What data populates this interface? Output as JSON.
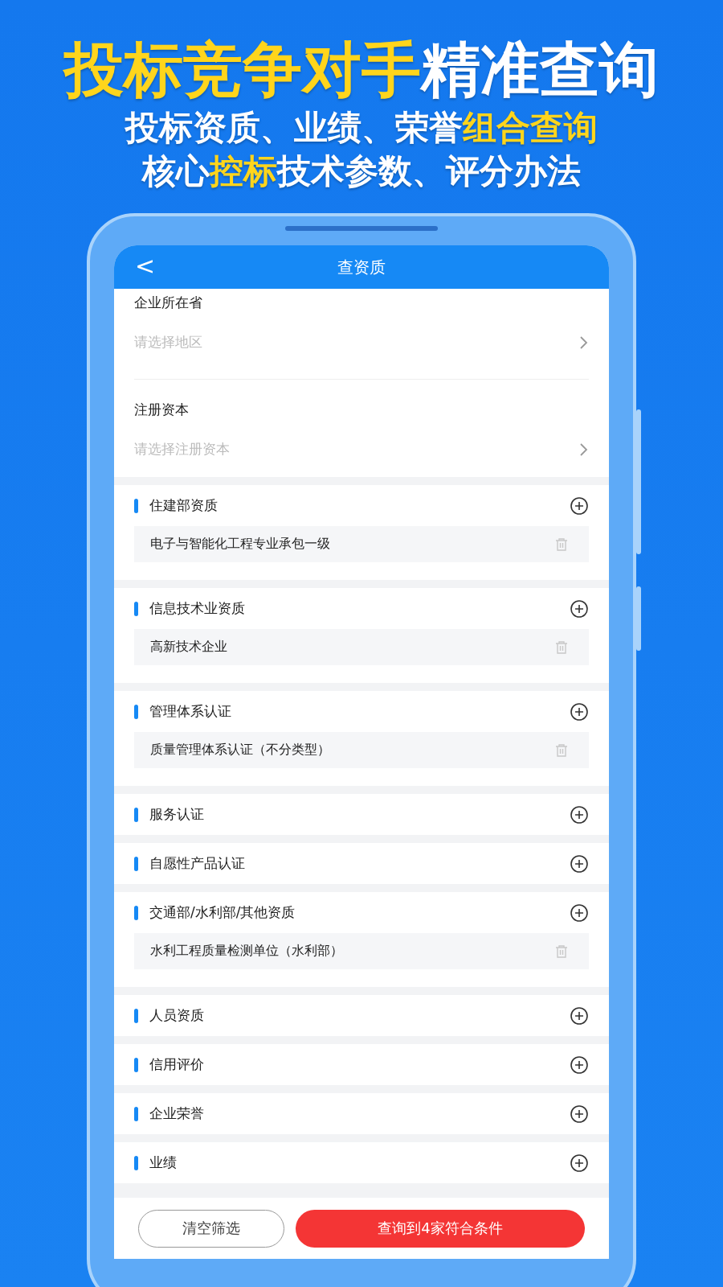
{
  "headline": [
    [
      {
        "text": "投标竞争对手",
        "highlight": true
      },
      {
        "text": "精准查询",
        "highlight": false
      }
    ],
    [
      {
        "text": "投标资质、业绩、荣誉",
        "highlight": false
      },
      {
        "text": "组合查询",
        "highlight": true
      }
    ],
    [
      {
        "text": "核心",
        "highlight": false
      },
      {
        "text": "控标",
        "highlight": true
      },
      {
        "text": "技术参数、评分办法",
        "highlight": false
      }
    ]
  ],
  "nav": {
    "back": "<",
    "title": "查资质"
  },
  "fields": [
    {
      "label": "企业所在省",
      "placeholder": "请选择地区"
    },
    {
      "label": "注册资本",
      "placeholder": "请选择注册资本"
    }
  ],
  "sections": [
    {
      "title": "住建部资质",
      "items": [
        "电子与智能化工程专业承包一级"
      ]
    },
    {
      "title": "信息技术业资质",
      "items": [
        "高新技术企业"
      ]
    },
    {
      "title": "管理体系认证",
      "items": [
        "质量管理体系认证（不分类型）"
      ]
    },
    {
      "title": "服务认证"
    },
    {
      "title": "自愿性产品认证"
    },
    {
      "title": "交通部/水利部/其他资质",
      "items": [
        "水利工程质量检测单位（水利部）"
      ]
    },
    {
      "title": "人员资质"
    },
    {
      "title": "信用评价"
    },
    {
      "title": "企业荣誉"
    },
    {
      "title": "业绩"
    }
  ],
  "footer": {
    "clear": "清空筛选",
    "submit": "查询到4家符合条件"
  }
}
